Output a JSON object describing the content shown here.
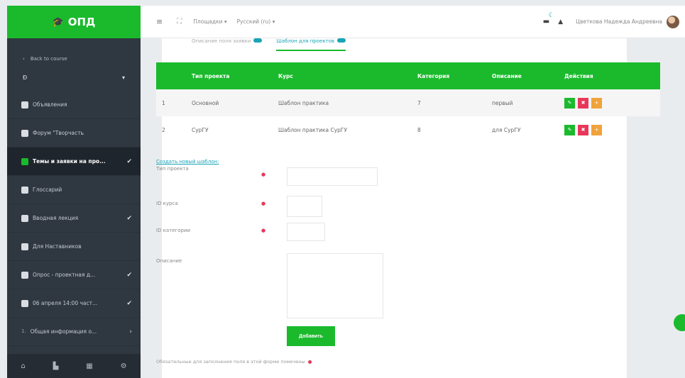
{
  "brand": {
    "name": "ОПД",
    "icon": "graduation-cap-icon"
  },
  "nav": {
    "back": "Back to course",
    "section": "Ð",
    "items": [
      {
        "label": "Объявления",
        "icon": "forum-icon",
        "check": ""
      },
      {
        "label": "Форум \"Творчасть",
        "icon": "forum-icon",
        "check": ""
      },
      {
        "label": "Темы и заявки на про...",
        "icon": "lightbulb-icon",
        "check": "✔",
        "active": true
      },
      {
        "label": "Глоссарий",
        "icon": "book-icon",
        "check": ""
      },
      {
        "label": "Вводная лекция",
        "icon": "page-icon",
        "check": "✔"
      },
      {
        "label": "Для Наставников",
        "icon": "folder-icon",
        "check": ""
      },
      {
        "label": "Опрос - проектная д...",
        "icon": "survey-icon",
        "check": "✔"
      },
      {
        "label": "06 апреля 14:00 част...",
        "icon": "page-icon",
        "check": "✔"
      },
      {
        "label": "Общая информация о...",
        "icon": "1.",
        "check": "›"
      }
    ],
    "footer_icons": [
      "home-icon",
      "file-icon",
      "grid-icon",
      "settings-icon"
    ]
  },
  "topbar": {
    "menu1": "Площадки ▾",
    "menu2": "Русский (ru) ▾",
    "user": "Цветкова Надежда Андреевна"
  },
  "tabs": [
    {
      "label": "Описание поля заявки"
    },
    {
      "label": "Шаблон для проектов",
      "active": true
    }
  ],
  "table": {
    "headers": [
      "",
      "Тип проекта",
      "Курс",
      "Категория",
      "Описание",
      "Действия"
    ],
    "rows": [
      {
        "n": "1",
        "type": "Основной",
        "course": "Шаблон практика",
        "category": "7",
        "desc": "первый"
      },
      {
        "n": "2",
        "type": "СурГУ",
        "course": "Шаблон практика СурГУ",
        "category": "8",
        "desc": "для СурГУ"
      }
    ]
  },
  "form": {
    "new_link": "Создать новый шаблон:",
    "fields": [
      {
        "label": "Тип проекта",
        "value": ""
      },
      {
        "label": "ID курса",
        "value": ""
      },
      {
        "label": "ID категории",
        "value": ""
      },
      {
        "label": "Описание",
        "value": ""
      }
    ],
    "submit": "Добавить",
    "note": "Обязательные для заполнения поля в этой форме помечены"
  },
  "colors": {
    "accent": "#1aba2c",
    "danger": "#e8385a",
    "warning": "#f0a33a",
    "sidebar": "#2f3740",
    "link": "#19a4b8"
  }
}
